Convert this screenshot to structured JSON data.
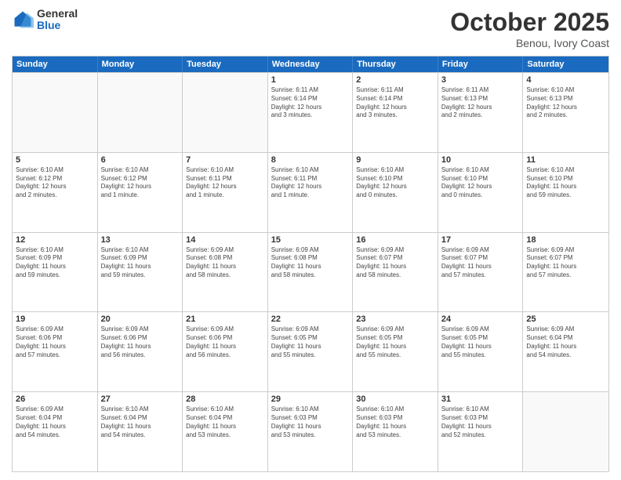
{
  "logo": {
    "general": "General",
    "blue": "Blue"
  },
  "header": {
    "month": "October 2025",
    "location": "Benou, Ivory Coast"
  },
  "weekdays": [
    "Sunday",
    "Monday",
    "Tuesday",
    "Wednesday",
    "Thursday",
    "Friday",
    "Saturday"
  ],
  "rows": [
    [
      {
        "day": "",
        "info": ""
      },
      {
        "day": "",
        "info": ""
      },
      {
        "day": "",
        "info": ""
      },
      {
        "day": "1",
        "info": "Sunrise: 6:11 AM\nSunset: 6:14 PM\nDaylight: 12 hours\nand 3 minutes."
      },
      {
        "day": "2",
        "info": "Sunrise: 6:11 AM\nSunset: 6:14 PM\nDaylight: 12 hours\nand 3 minutes."
      },
      {
        "day": "3",
        "info": "Sunrise: 6:11 AM\nSunset: 6:13 PM\nDaylight: 12 hours\nand 2 minutes."
      },
      {
        "day": "4",
        "info": "Sunrise: 6:10 AM\nSunset: 6:13 PM\nDaylight: 12 hours\nand 2 minutes."
      }
    ],
    [
      {
        "day": "5",
        "info": "Sunrise: 6:10 AM\nSunset: 6:12 PM\nDaylight: 12 hours\nand 2 minutes."
      },
      {
        "day": "6",
        "info": "Sunrise: 6:10 AM\nSunset: 6:12 PM\nDaylight: 12 hours\nand 1 minute."
      },
      {
        "day": "7",
        "info": "Sunrise: 6:10 AM\nSunset: 6:11 PM\nDaylight: 12 hours\nand 1 minute."
      },
      {
        "day": "8",
        "info": "Sunrise: 6:10 AM\nSunset: 6:11 PM\nDaylight: 12 hours\nand 1 minute."
      },
      {
        "day": "9",
        "info": "Sunrise: 6:10 AM\nSunset: 6:10 PM\nDaylight: 12 hours\nand 0 minutes."
      },
      {
        "day": "10",
        "info": "Sunrise: 6:10 AM\nSunset: 6:10 PM\nDaylight: 12 hours\nand 0 minutes."
      },
      {
        "day": "11",
        "info": "Sunrise: 6:10 AM\nSunset: 6:10 PM\nDaylight: 11 hours\nand 59 minutes."
      }
    ],
    [
      {
        "day": "12",
        "info": "Sunrise: 6:10 AM\nSunset: 6:09 PM\nDaylight: 11 hours\nand 59 minutes."
      },
      {
        "day": "13",
        "info": "Sunrise: 6:10 AM\nSunset: 6:09 PM\nDaylight: 11 hours\nand 59 minutes."
      },
      {
        "day": "14",
        "info": "Sunrise: 6:09 AM\nSunset: 6:08 PM\nDaylight: 11 hours\nand 58 minutes."
      },
      {
        "day": "15",
        "info": "Sunrise: 6:09 AM\nSunset: 6:08 PM\nDaylight: 11 hours\nand 58 minutes."
      },
      {
        "day": "16",
        "info": "Sunrise: 6:09 AM\nSunset: 6:07 PM\nDaylight: 11 hours\nand 58 minutes."
      },
      {
        "day": "17",
        "info": "Sunrise: 6:09 AM\nSunset: 6:07 PM\nDaylight: 11 hours\nand 57 minutes."
      },
      {
        "day": "18",
        "info": "Sunrise: 6:09 AM\nSunset: 6:07 PM\nDaylight: 11 hours\nand 57 minutes."
      }
    ],
    [
      {
        "day": "19",
        "info": "Sunrise: 6:09 AM\nSunset: 6:06 PM\nDaylight: 11 hours\nand 57 minutes."
      },
      {
        "day": "20",
        "info": "Sunrise: 6:09 AM\nSunset: 6:06 PM\nDaylight: 11 hours\nand 56 minutes."
      },
      {
        "day": "21",
        "info": "Sunrise: 6:09 AM\nSunset: 6:06 PM\nDaylight: 11 hours\nand 56 minutes."
      },
      {
        "day": "22",
        "info": "Sunrise: 6:09 AM\nSunset: 6:05 PM\nDaylight: 11 hours\nand 55 minutes."
      },
      {
        "day": "23",
        "info": "Sunrise: 6:09 AM\nSunset: 6:05 PM\nDaylight: 11 hours\nand 55 minutes."
      },
      {
        "day": "24",
        "info": "Sunrise: 6:09 AM\nSunset: 6:05 PM\nDaylight: 11 hours\nand 55 minutes."
      },
      {
        "day": "25",
        "info": "Sunrise: 6:09 AM\nSunset: 6:04 PM\nDaylight: 11 hours\nand 54 minutes."
      }
    ],
    [
      {
        "day": "26",
        "info": "Sunrise: 6:09 AM\nSunset: 6:04 PM\nDaylight: 11 hours\nand 54 minutes."
      },
      {
        "day": "27",
        "info": "Sunrise: 6:10 AM\nSunset: 6:04 PM\nDaylight: 11 hours\nand 54 minutes."
      },
      {
        "day": "28",
        "info": "Sunrise: 6:10 AM\nSunset: 6:04 PM\nDaylight: 11 hours\nand 53 minutes."
      },
      {
        "day": "29",
        "info": "Sunrise: 6:10 AM\nSunset: 6:03 PM\nDaylight: 11 hours\nand 53 minutes."
      },
      {
        "day": "30",
        "info": "Sunrise: 6:10 AM\nSunset: 6:03 PM\nDaylight: 11 hours\nand 53 minutes."
      },
      {
        "day": "31",
        "info": "Sunrise: 6:10 AM\nSunset: 6:03 PM\nDaylight: 11 hours\nand 52 minutes."
      },
      {
        "day": "",
        "info": ""
      }
    ]
  ]
}
